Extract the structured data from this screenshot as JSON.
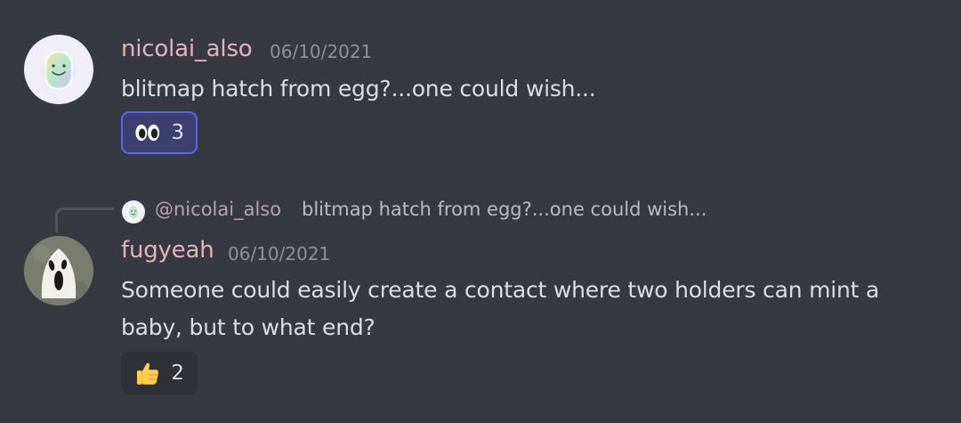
{
  "messages": [
    {
      "username": "nicolai_also",
      "timestamp": "06/10/2021",
      "text": "blitmap hatch from egg?...one could wish...",
      "reaction": {
        "icon": "eyes-emoji-icon",
        "count": "3",
        "active": true
      }
    },
    {
      "reply_to": {
        "username": "@nicolai_also",
        "text": "blitmap hatch from egg?...one could wish..."
      },
      "username": "fugyeah",
      "timestamp": "06/10/2021",
      "text_line1": "Someone could easily create a contact where two holders can mint a",
      "text_line2": "baby, but to what end?",
      "reaction": {
        "icon": "thumbs-up-emoji-icon",
        "count": "2",
        "active": false
      }
    }
  ],
  "colors": {
    "background": "#36393f",
    "username": "#e3b3bb",
    "timestamp": "#8e9297",
    "text": "#dcddde",
    "reaction_active_border": "#5865f2"
  }
}
